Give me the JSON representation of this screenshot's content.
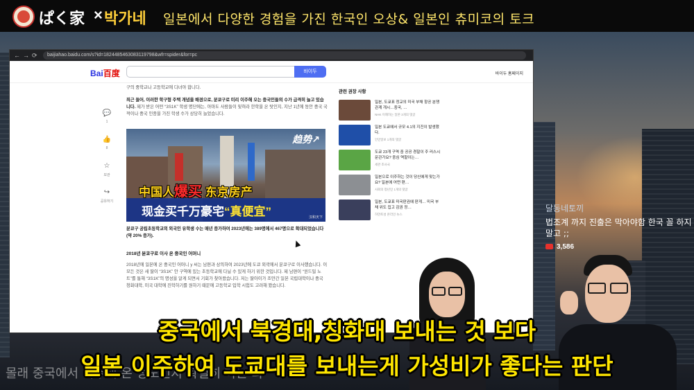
{
  "channel": {
    "name_jp": "ぱく家",
    "separator": "×",
    "name_kr": "박가네",
    "description": "일본에서 다양한 경험을 가진 한국인 오상& 일본인 츄미코의 토크"
  },
  "browser": {
    "url": "baijiahao.baidu.com/s?id=1824485463083119798&wfr=spider&for=pc",
    "nav": {
      "back": "←",
      "forward": "→",
      "reload": "⟳"
    },
    "search_button_label": "바이두",
    "top_links": "바이두  홈페이지",
    "logo_text": "Bai",
    "logo_text_red": "百度"
  },
  "article": {
    "para1": "구의 중학교나 고등학교에 다녀야 합니다.",
    "para2_bold": "최근 들어, 이러한 학구형 주택 개념을 배경으로, 분쿄구로 미리 이주해 오는 중국인들의 수가 급격히 늘고 있습니다.",
    "para2_rest": "제가 받은 어떤 “3S1K” 학생 명단에는, 아마도 사람들이 잊혀라 한학을 온 탓인지, 지난 1년에 동안 중국 국적이나 중국 인종을 가진 학생 수가 상당히 늘었습니다.",
    "hero": {
      "tag": "趋势↗",
      "line1_a": "中国人",
      "line1_red": "爆买",
      "line1_b": "东京房产",
      "line2_a": "现金买千万豪宅",
      "line2_y": "“真便宜”",
      "watermark": "汉和天下"
    },
    "para3_bold": "분쿄구 공립초등학교의 외국인 유학생 수는 매년 증가하여 2023년에는 389명에서 467명으로 확대되었습니다(약 20% 증가).",
    "subhead": "2018년 분쿄구로 이사 온 중국인 어머니",
    "para4": "2018년에 일본에 온 중국인 어머니 y 씨는 남편과 상의하여 2023년에 도쿄 외곽에서 분쿄구로 이사했습니다. 이 모든 것은 새 딸이 “3S1K” 안 구역에 있는 초등학교에 다닐 수 있게 하기 위한 것입니다. 제 남편이 “윈드밀 노트”를 통해 “3S1K”의 명성을 알게 되면서 기회가 찾아왔습니다. 저는 딸아이가 조만간 일본 국립대학이나 중국 청화대학, 미국 대학에 진학하기를 원하기 때문에 고등학교 입학 시험도 고려해 봤습니다."
  },
  "side_actions": [
    {
      "icon": "💬",
      "label": "1"
    },
    {
      "icon": "👍",
      "label": "8"
    },
    {
      "icon": "☆",
      "label": "보관"
    },
    {
      "icon": "↪",
      "label": "공유하기"
    }
  ],
  "sidebar": {
    "title": "관련 권장 사항",
    "items": [
      {
        "title": "일본, 도쿄표 정교의 미국 부채 항공 분쟁 관계 개시…중국, …",
        "meta": "NHK 이해하는 일본  3개의 댓글",
        "color": "#6b4a3a"
      },
      {
        "title": "일본 도쿄에서 규모 4.1의 지진이 발생했다.",
        "meta": "인민일보  1개의 댓글",
        "color": "#1f4fa8"
      },
      {
        "title": "도쿄 23개 구역 중 공공 경찰이 주 러스시문관가요? 중심 역할이는…",
        "meta": "세관 조사국",
        "color": "#5aa545"
      },
      {
        "title": "일본으로 이주하는 것이 당신에게 맞는가요? 일본에 어떤 편…",
        "meta": "사회의 청년민  1개의 댓글",
        "color": "#8c8f93"
      },
      {
        "title": "일본, 도쿄표 미국판권에 판게… 미국 부채 위도 집고 감권 정…",
        "meta": "하얀토성 온라인 뉴스",
        "color": "#3a3f5c"
      }
    ]
  },
  "chat": {
    "username": "달동네토끼",
    "message": "법조계 까지 진출은 막아야함 한국 꼴 하지말고 ;;",
    "amount": "3,586"
  },
  "subtitles": {
    "line1": "중국에서 북경대,칭화대 보내는 것 보다",
    "line2": "일본 이주하여 도쿄대를 보내는게 가성비가 좋다는 판단",
    "ghost": "몰래 중국에서 이주해 온 정도인지 확실히 하는 화"
  },
  "colors": {
    "subtitle": "#ffe600",
    "channel_kr": "#ffcf3a",
    "description": "#ffe66b",
    "baidu_blue": "#4e6ef2"
  }
}
